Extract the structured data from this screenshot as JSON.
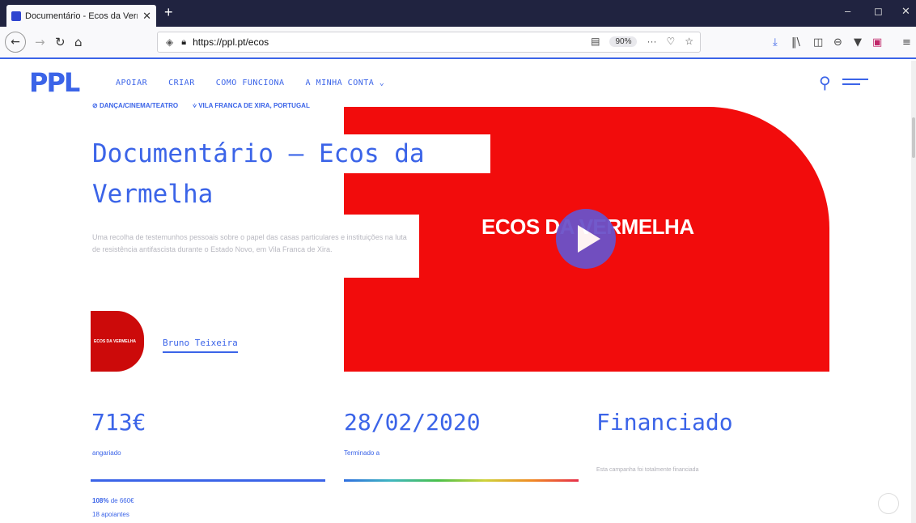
{
  "browser": {
    "tab_title": "Documentário - Ecos da Verme",
    "tab_close": "✕",
    "new_tab": "+",
    "url": "https://ppl.pt/ecos",
    "zoom": "90%",
    "url_more": "···",
    "window_controls": {
      "minimize": "‒",
      "maximize": "◻",
      "close": "✕"
    }
  },
  "site": {
    "logo": "PPL",
    "nav": [
      "APOIAR",
      "CRIAR",
      "COMO FUNCIONA",
      "A MINHA CONTA ⌄"
    ]
  },
  "campaign": {
    "tags": [
      "DANÇA/CINEMA/TEATRO",
      "VILA FRANCA DE XIRA, PORTUGAL"
    ],
    "title_line1": "Documentário – Ecos da",
    "title_line2": "Vermelha",
    "description": "Uma recolha de testemunhos pessoais sobre o papel das casas particulares e instituições na luta de resistência antifascista durante o Estado Novo, em Vila Franca de Xira.",
    "video_title": "ECOS DA VERMELHA",
    "avatar_text": "ECOS DA VERMELHA",
    "author": "Bruno Teixeira"
  },
  "stats": {
    "raised": "713€",
    "raised_label": "angariado",
    "end_date": "28/02/2020",
    "end_label": "Terminado a",
    "status": "Financiado",
    "status_note": "Esta campanha foi totalmente financiada",
    "progress_pct": "108%",
    "progress_of": " de 660€",
    "supporters": "18 apoiantes",
    "progress_fraction": 1.08
  }
}
